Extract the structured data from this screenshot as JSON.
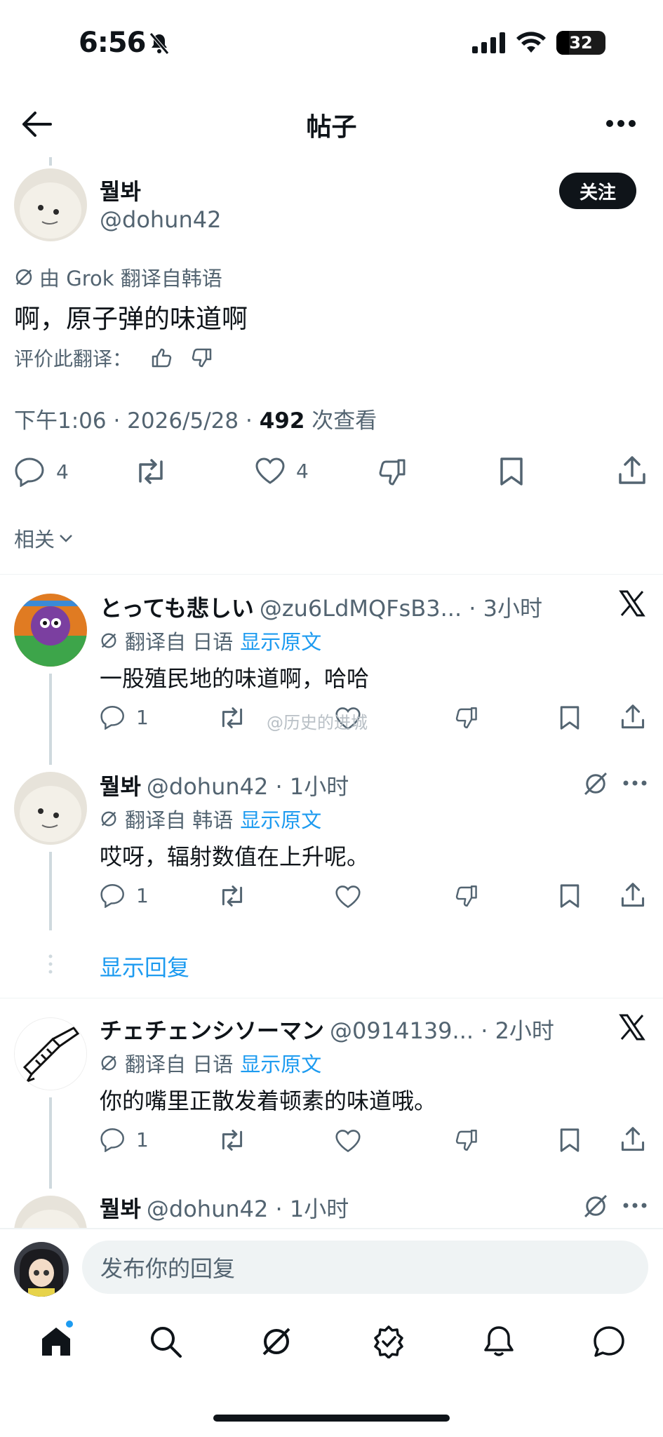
{
  "status": {
    "time": "6:56",
    "battery": "32"
  },
  "header": {
    "title": "帖子"
  },
  "post": {
    "name": "뭘봐",
    "handle": "@dohun42",
    "follow": "关注",
    "translated_by": "由 Grok 翻译自韩语",
    "body": "啊，原子弹的味道啊",
    "rate_label": "评价此翻译：",
    "time": "下午1:06 · 2026/5/28 · ",
    "views_count": "492",
    "views_label": " 次查看",
    "reply_count": "4",
    "like_count": "4",
    "related": "相关"
  },
  "replies": [
    {
      "name": "とっても悲しい",
      "meta": "@zu6LdMQFsB3... · 3小时",
      "translated": "翻译自 日语",
      "show_original": "显示原文",
      "body": "一股殖民地的味道啊，哈哈",
      "reply_count": "1"
    },
    {
      "name": "뭘봐",
      "meta": "@dohun42 · 1小时",
      "translated": "翻译自 韩语",
      "show_original": "显示原文",
      "body": "哎呀，辐射数值在上升呢。",
      "reply_count": "1"
    },
    {
      "name": "チェチェンシソーマン",
      "meta": "@0914139... · 2小时",
      "translated": "翻译自 日语",
      "show_original": "显示原文",
      "body": "你的嘴里正散发着顿素的味道哦。",
      "reply_count": "1"
    },
    {
      "name": "뭘봐",
      "meta": "@dohun42 · 1小时"
    }
  ],
  "show_replies": "显示回复",
  "watermark": "@历史的进城",
  "compose": {
    "placeholder": "发布你的回复"
  },
  "colors": {
    "accent": "#1d9bf0",
    "text": "#0f1419",
    "muted": "#536471"
  }
}
